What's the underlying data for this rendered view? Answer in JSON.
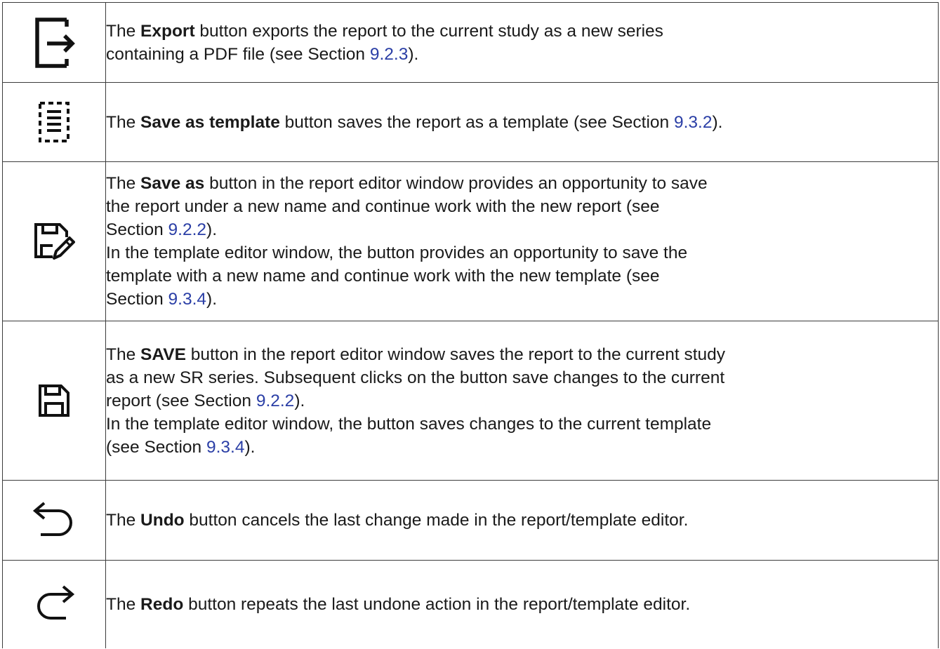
{
  "rows": [
    {
      "icon": "export-icon",
      "lines": [
        {
          "pre": "The ",
          "bold": "Export",
          "post": " button exports the report to the current study as a new series"
        },
        {
          "pre": "containing a PDF file (see Section ",
          "link": "9.2.3",
          "post": ")."
        }
      ]
    },
    {
      "icon": "save-as-template-icon",
      "lines": [
        {
          "pre": "The ",
          "bold": "Save as template",
          "post": " button saves the report as a template (see Section ",
          "link": "9.3.2",
          "post2": ")."
        }
      ]
    },
    {
      "icon": "save-as-icon",
      "lines": [
        {
          "pre": "The ",
          "bold": "Save as",
          "post": " button in the report editor window provides an opportunity to save"
        },
        {
          "pre": "the report under a new name and continue work with the new report (see"
        },
        {
          "pre": "Section ",
          "link": "9.2.2",
          "post": ")."
        },
        {
          "pre": "In the template editor window, the button provides an opportunity to save the"
        },
        {
          "pre": "template with a new name and continue work with the new template (see"
        },
        {
          "pre": "Section ",
          "link": "9.3.4",
          "post": ")."
        }
      ]
    },
    {
      "icon": "save-icon",
      "lines": [
        {
          "pre": "The ",
          "bold": "SAVE",
          "post": " button in the report editor window saves the report to the current study"
        },
        {
          "pre": "as a new SR series. Subsequent clicks on the button save changes to the current"
        },
        {
          "pre": "report (see Section ",
          "link": "9.2.2",
          "post": ")."
        },
        {
          "pre": "In the template editor window, the button saves changes to the current template"
        },
        {
          "pre": "(see Section ",
          "link": "9.3.4",
          "post": ")."
        }
      ]
    },
    {
      "icon": "undo-icon",
      "lines": [
        {
          "pre": "The ",
          "bold": "Undo",
          "post": " button cancels the last change made in the report/template editor."
        }
      ]
    },
    {
      "icon": "redo-icon",
      "lines": [
        {
          "pre": "The ",
          "bold": "Redo",
          "post": " button repeats the last undone action in the report/template editor."
        }
      ]
    }
  ]
}
